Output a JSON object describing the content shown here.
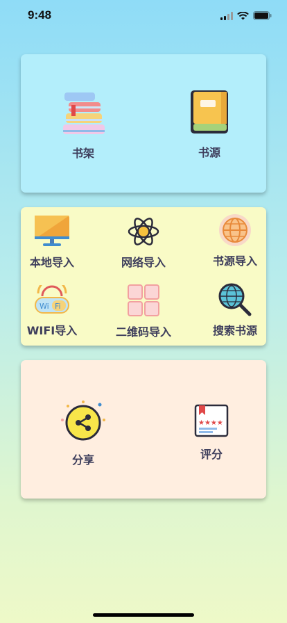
{
  "status_bar": {
    "time": "9:48",
    "icons": [
      "signal-icon",
      "wifi-icon",
      "battery-icon"
    ]
  },
  "top_card": {
    "items": [
      {
        "label": "书架",
        "icon": "bookshelf-icon"
      },
      {
        "label": "书源",
        "icon": "book-icon"
      }
    ]
  },
  "import_card": {
    "items": [
      {
        "label": "本地导入",
        "icon": "monitor-icon"
      },
      {
        "label": "网络导入",
        "icon": "atom-icon"
      },
      {
        "label": "书源导入",
        "icon": "globe-icon"
      },
      {
        "label": "WIFI导入",
        "icon": "wifi-cloud-icon"
      },
      {
        "label": "二维码导入",
        "icon": "qrcode-icon"
      },
      {
        "label": "搜索书源",
        "icon": "search-globe-icon"
      }
    ]
  },
  "bottom_card": {
    "items": [
      {
        "label": "分享",
        "icon": "share-icon"
      },
      {
        "label": "评分",
        "icon": "rating-icon"
      }
    ]
  },
  "colors": {
    "top_card": "#b3eefb",
    "import_card": "#f9fbc6",
    "bottom_card": "#ffeee0",
    "label": "#3e3e5c"
  }
}
